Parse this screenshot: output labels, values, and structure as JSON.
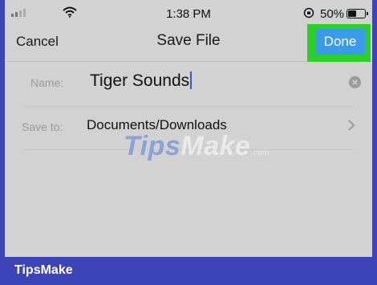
{
  "status_bar": {
    "time": "1:38 PM",
    "battery_percent": "50%",
    "battery_level": 0.5
  },
  "nav": {
    "cancel_label": "Cancel",
    "title": "Save File",
    "done_label": "Done"
  },
  "form": {
    "name_label": "Name:",
    "name_value": "Tiger Sounds",
    "save_to_label": "Save to:",
    "save_to_value": "Documents/Downloads"
  },
  "watermark": {
    "brand_left": "Tips",
    "brand_right": "Make",
    "suffix": ".com"
  },
  "footer": {
    "brand": "TipsMake"
  },
  "colors": {
    "frame": "#3c44b8",
    "done_button": "#3a9ce8",
    "highlight": "#2bd02b",
    "background": "#d2d2d2"
  }
}
